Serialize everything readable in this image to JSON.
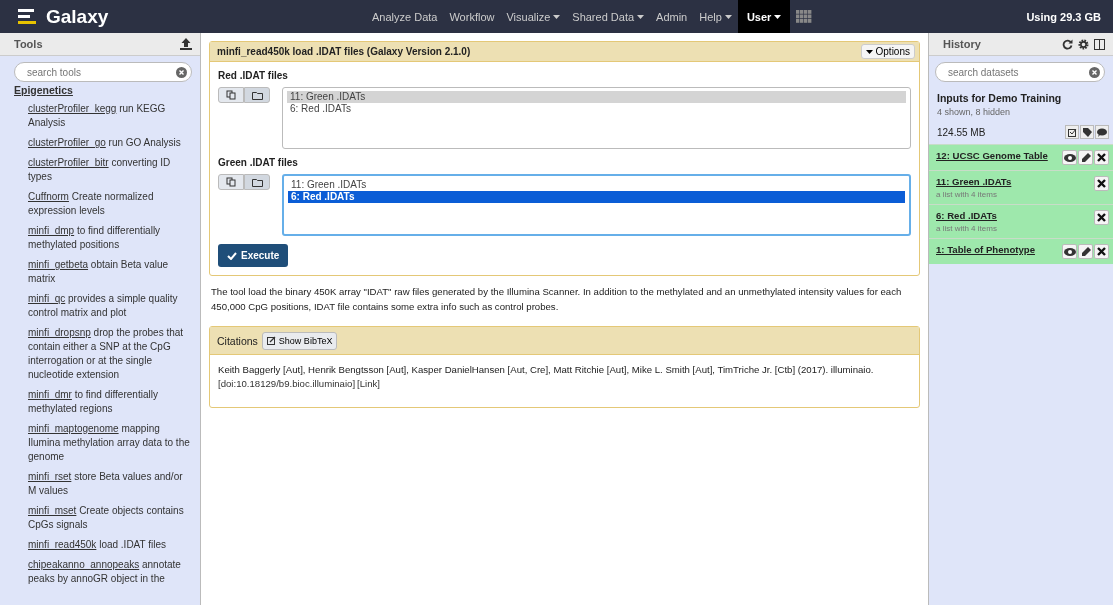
{
  "brand": "Galaxy",
  "nav": [
    {
      "label": "Analyze Data",
      "dropdown": false,
      "selected": false
    },
    {
      "label": "Workflow",
      "dropdown": false,
      "selected": false
    },
    {
      "label": "Visualize",
      "dropdown": true,
      "selected": false
    },
    {
      "label": "Shared Data",
      "dropdown": true,
      "selected": false
    },
    {
      "label": "Admin",
      "dropdown": false,
      "selected": false
    },
    {
      "label": "Help",
      "dropdown": true,
      "selected": false
    },
    {
      "label": "User",
      "dropdown": true,
      "selected": true
    }
  ],
  "usage": "Using 29.3 GB",
  "tools": {
    "title": "Tools",
    "search_placeholder": "search tools",
    "section": "Epigenetics",
    "items": [
      {
        "name": "clusterProfiler_kegg",
        "desc": "run KEGG Analysis"
      },
      {
        "name": "clusterProfiler_go",
        "desc": "run GO Analysis"
      },
      {
        "name": "clusterProfiler_bitr",
        "desc": "converting ID types"
      },
      {
        "name": "Cuffnorm",
        "desc": "Create normalized expression levels"
      },
      {
        "name": "minfi_dmp",
        "desc": "to find differentially methylated positions"
      },
      {
        "name": "minfi_getbeta",
        "desc": "obtain Beta value matrix"
      },
      {
        "name": "minfi_qc",
        "desc": "provides a simple quality control matrix and plot"
      },
      {
        "name": "minfi_dropsnp",
        "desc": "drop the probes that contain either a SNP at the CpG interrogation or at the single nucleotide extension"
      },
      {
        "name": "minfi_dmr",
        "desc": "to find differentially methylated regions"
      },
      {
        "name": "minfi_maptogenome",
        "desc": "mapping Ilumina methylation array data to the genome"
      },
      {
        "name": "minfi_rset",
        "desc": "store Beta values and/or M values"
      },
      {
        "name": "minfi_mset",
        "desc": "Create objects contains CpGs signals"
      },
      {
        "name": "minfi_read450k",
        "desc": "load .IDAT files"
      },
      {
        "name": "chipeakanno_annopeaks",
        "desc": "annotate peaks by annoGR object in the"
      }
    ]
  },
  "tool_form": {
    "title": "minfi_read450k load .IDAT files (Galaxy Version 2.1.0)",
    "options_label": "Options",
    "params": [
      {
        "label": "Red .IDAT files",
        "focused": false,
        "options": [
          {
            "label": "11: Green .IDATs",
            "selected": true
          },
          {
            "label": "6: Red .IDATs",
            "selected": false
          }
        ]
      },
      {
        "label": "Green .IDAT files",
        "focused": true,
        "options": [
          {
            "label": "11: Green .IDATs",
            "selected": false
          },
          {
            "label": "6: Red .IDATs",
            "selected": true
          }
        ]
      }
    ],
    "execute_label": "Execute"
  },
  "help": "The tool load the binary 450K array \"IDAT\" raw files generated by the Illumina Scanner. In addition to the methylated and an unmethylated intensity values for each 450,000 CpG positions, IDAT file contains some extra info such as control probes.",
  "citations": {
    "title": "Citations",
    "bibtex_label": "Show BibTeX",
    "text": "Keith Baggerly [Aut], Henrik Bengtsson [Aut], Kasper DanielHansen [Aut, Cre], Matt Ritchie [Aut], Mike L. Smith [Aut], TimTriche Jr. [Ctb] (2017). illuminaio.",
    "doi_link": "[doi:10.18129/b9.bioc.illuminaio]",
    "link": "[Link]"
  },
  "history": {
    "title": "History",
    "search_placeholder": "search datasets",
    "name": "Inputs for Demo Training",
    "shown": "4 shown, 8",
    "hidden_link": "hidden",
    "size": "124.55 MB",
    "items": [
      {
        "title": "12: UCSC Genome Table",
        "actions": [
          {
            "kind": "view"
          },
          {
            "kind": "edit"
          },
          {
            "kind": "delete"
          }
        ]
      },
      {
        "title": "11: Green .IDATs",
        "subtitle": "a list with 4 items",
        "actions": [
          {
            "kind": "delete"
          }
        ]
      },
      {
        "title": "6: Red .IDATs",
        "subtitle": "a list with 4 items",
        "actions": [
          {
            "kind": "delete"
          }
        ]
      },
      {
        "title": "1: Table of Phenotype",
        "actions": [
          {
            "kind": "view"
          },
          {
            "kind": "edit"
          },
          {
            "kind": "delete"
          }
        ]
      }
    ]
  }
}
